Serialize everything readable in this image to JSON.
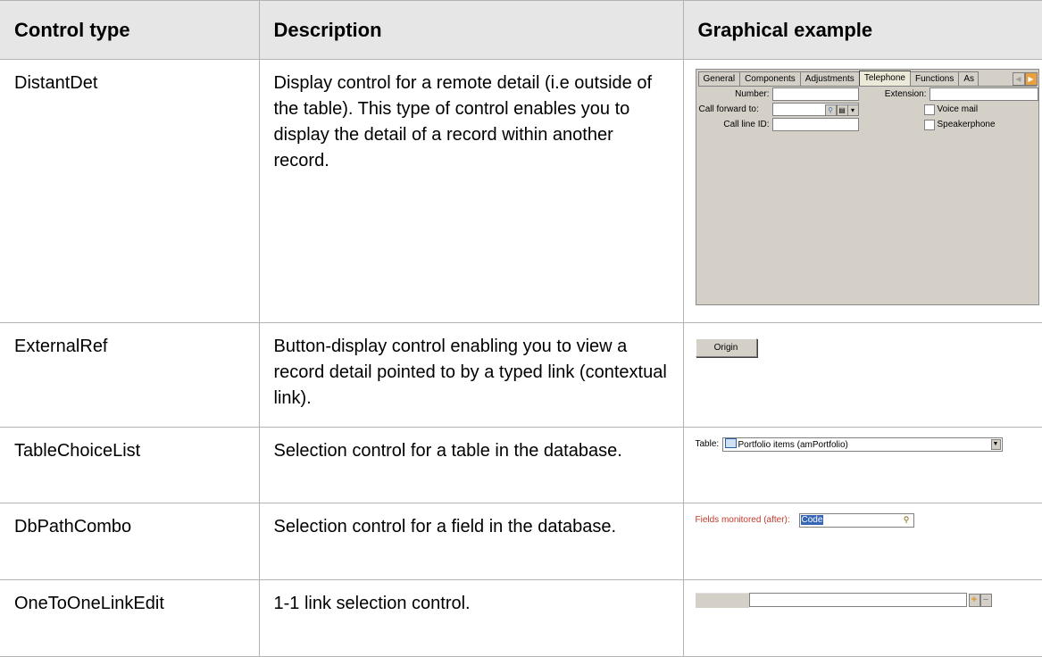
{
  "table": {
    "headers": {
      "control_type": "Control type",
      "description": "Description",
      "graphical_example": "Graphical example"
    },
    "rows": [
      {
        "control_type": "DistantDet",
        "description": "Display control for a remote detail (i.e outside of the table). This type of control enables you to display the detail of a record within another record."
      },
      {
        "control_type": "ExternalRef",
        "description": "Button-display control enabling you to view a record detail pointed to by a typed link (contextual link)."
      },
      {
        "control_type": "TableChoiceList",
        "description": "Selection control for a table in the database."
      },
      {
        "control_type": "DbPathCombo",
        "description": "Selection control for a field in the database."
      },
      {
        "control_type": "OneToOneLinkEdit",
        "description": "1-1 link selection control."
      }
    ]
  },
  "examples": {
    "distantdet": {
      "tabs": [
        "General",
        "Components",
        "Adjustments",
        "Telephone",
        "Functions",
        "As"
      ],
      "active_tab": "Telephone",
      "number_label": "Number:",
      "extension_label": "Extension:",
      "call_forward_label": "Call forward to:",
      "call_line_label": "Call line ID:",
      "voice_mail_label": "Voice mail",
      "speakerphone_label": "Speakerphone"
    },
    "externalref": {
      "button_label": "Origin"
    },
    "tablechoicelist": {
      "label": "Table:",
      "value": "Portfolio items (amPortfolio)"
    },
    "dbpathcombo": {
      "label": "Fields monitored (after):",
      "value": "Code"
    },
    "onetoone": {
      "plus": "+",
      "minus": "−"
    }
  }
}
